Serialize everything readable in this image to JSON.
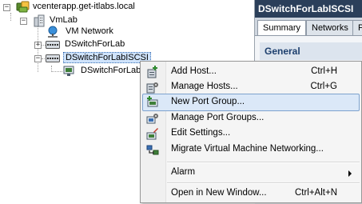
{
  "tree": {
    "root_label": "vcenterapp.get-itlabs.local",
    "datacenter_label": "VmLab",
    "items": [
      {
        "label": "VM Network"
      },
      {
        "label": "DSwitchForLab"
      },
      {
        "label": "DSwitchForLabISCSI"
      },
      {
        "label": "DSwitchForLabISCSI"
      }
    ]
  },
  "right_panel": {
    "title": "DSwitchForLabISCSI",
    "tabs": [
      {
        "label": "Summary"
      },
      {
        "label": "Networks"
      },
      {
        "label": "P"
      }
    ],
    "section_title": "General"
  },
  "context_menu": {
    "items": [
      {
        "label": "Add Host...",
        "shortcut": "Ctrl+H",
        "icon": "add-host-icon"
      },
      {
        "label": "Manage Hosts...",
        "shortcut": "Ctrl+G",
        "icon": "manage-hosts-icon"
      },
      {
        "label": "New Port Group...",
        "shortcut": "",
        "icon": "new-port-group-icon"
      },
      {
        "label": "Manage Port Groups...",
        "shortcut": "",
        "icon": "manage-port-groups-icon"
      },
      {
        "label": "Edit Settings...",
        "shortcut": "",
        "icon": "edit-settings-icon"
      },
      {
        "label": "Migrate Virtual Machine Networking...",
        "shortcut": "",
        "icon": "migrate-networking-icon"
      },
      {
        "label": "Alarm",
        "shortcut": ""
      },
      {
        "label": "Open in New Window...",
        "shortcut": "Ctrl+Alt+N"
      }
    ]
  },
  "colors": {
    "title_bar": "#2b3f5a",
    "menu_highlight": "#dbe8f8",
    "selection": "#cfe3fb"
  }
}
